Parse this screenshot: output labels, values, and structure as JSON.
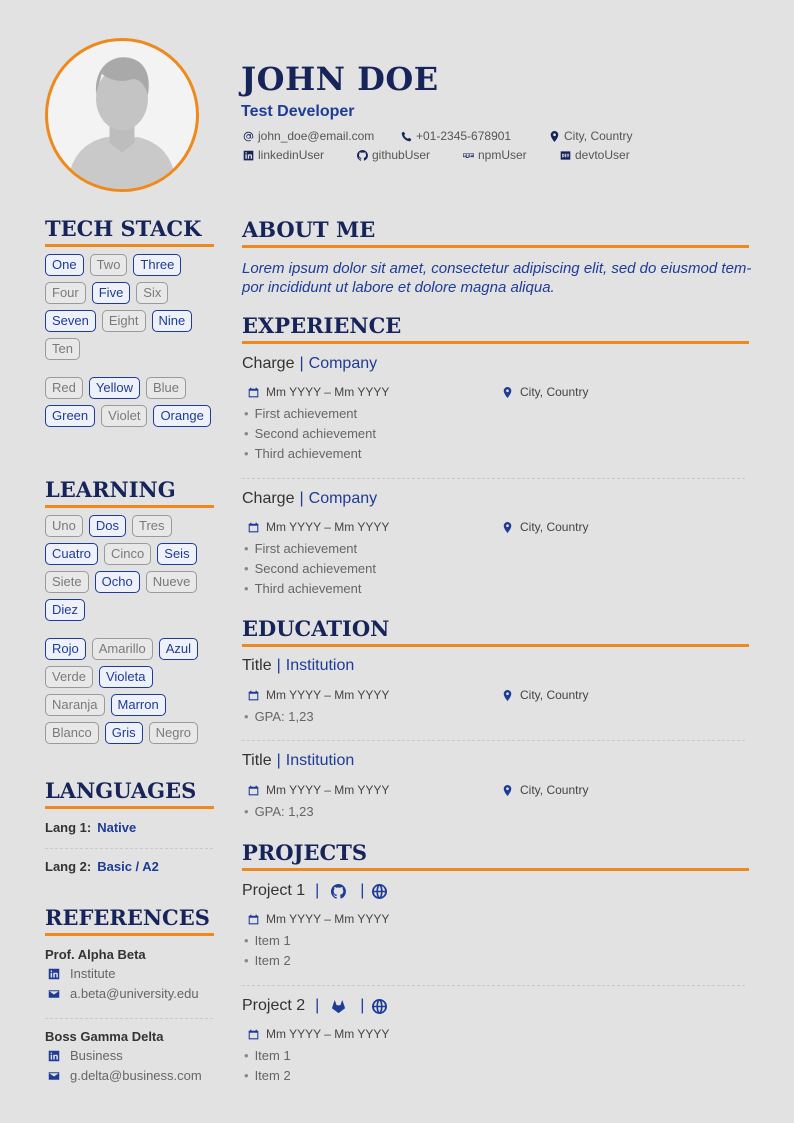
{
  "header": {
    "name": "JOHN DOE",
    "role": "Test Developer",
    "email": "john_doe@email.com",
    "phone": "+01-2345-678901",
    "location": "City, Country",
    "linkedin": "linkedinUser",
    "github": "githubUser",
    "npm": "npmUser",
    "devto": "devtoUser"
  },
  "sections": {
    "tech_stack": "TECH STACK",
    "learning": "LEARNING",
    "languages": "LANGUAGES",
    "references": "REFERENCES",
    "about": "ABOUT ME",
    "experience": "EXPERIENCE",
    "education": "EDUCATION",
    "projects": "PROJECTS"
  },
  "tech_stack": {
    "group1": [
      {
        "label": "One",
        "on": true
      },
      {
        "label": "Two",
        "on": false
      },
      {
        "label": "Three",
        "on": true
      },
      {
        "label": "Four",
        "on": false
      },
      {
        "label": "Five",
        "on": true
      },
      {
        "label": "Six",
        "on": false
      },
      {
        "label": "Seven",
        "on": true
      },
      {
        "label": "Eight",
        "on": false
      },
      {
        "label": "Nine",
        "on": true
      },
      {
        "label": "Ten",
        "on": false
      }
    ],
    "group2": [
      {
        "label": "Red",
        "on": false
      },
      {
        "label": "Yellow",
        "on": true
      },
      {
        "label": "Blue",
        "on": false
      },
      {
        "label": "Green",
        "on": true
      },
      {
        "label": "Violet",
        "on": false
      },
      {
        "label": "Orange",
        "on": true
      }
    ]
  },
  "learning": {
    "group1": [
      {
        "label": "Uno",
        "on": false
      },
      {
        "label": "Dos",
        "on": true
      },
      {
        "label": "Tres",
        "on": false
      },
      {
        "label": "Cuatro",
        "on": true
      },
      {
        "label": "Cinco",
        "on": false
      },
      {
        "label": "Seis",
        "on": true
      },
      {
        "label": "Siete",
        "on": false
      },
      {
        "label": "Ocho",
        "on": true
      },
      {
        "label": "Nueve",
        "on": false
      },
      {
        "label": "Diez",
        "on": true
      }
    ],
    "group2": [
      {
        "label": "Rojo",
        "on": true
      },
      {
        "label": "Amarillo",
        "on": false
      },
      {
        "label": "Azul",
        "on": true
      },
      {
        "label": "Verde",
        "on": false
      },
      {
        "label": "Violeta",
        "on": true
      },
      {
        "label": "Naranja",
        "on": false
      },
      {
        "label": "Marron",
        "on": true
      },
      {
        "label": "Blanco",
        "on": false
      },
      {
        "label": "Gris",
        "on": true
      },
      {
        "label": "Negro",
        "on": false
      }
    ]
  },
  "languages": [
    {
      "name": "Lang 1:",
      "level": "Native"
    },
    {
      "name": "Lang 2:",
      "level": "Basic / A2"
    }
  ],
  "references": [
    {
      "name": "Prof. Alpha Beta",
      "org": "Institute",
      "email": "a.beta@university.edu"
    },
    {
      "name": "Boss Gamma Delta",
      "org": "Business",
      "email": "g.delta@business.com"
    }
  ],
  "about": "Lorem ipsum dolor sit amet, consectetur adipiscing elit, sed do eiusmod tem-por incididunt ut labore et dolore magna aliqua.",
  "experience": [
    {
      "title": "Charge",
      "org": "Company",
      "dates": "Mm YYYY – Mm YYYY",
      "location": "City, Country",
      "items": [
        "First achievement",
        "Second achievement",
        "Third achievement"
      ]
    },
    {
      "title": "Charge",
      "org": "Company",
      "dates": "Mm YYYY – Mm YYYY",
      "location": "City, Country",
      "items": [
        "First achievement",
        "Second achievement",
        "Third achievement"
      ]
    }
  ],
  "education": [
    {
      "title": "Title",
      "org": "Institution",
      "dates": "Mm YYYY – Mm YYYY",
      "location": "City, Country",
      "items": [
        "GPA: 1,23"
      ]
    },
    {
      "title": "Title",
      "org": "Institution",
      "dates": "Mm YYYY – Mm YYYY",
      "location": "City, Country",
      "items": [
        "GPA: 1,23"
      ]
    }
  ],
  "projects": [
    {
      "title": "Project 1",
      "repo_icon": "github-icon",
      "dates": "Mm YYYY – Mm YYYY",
      "items": [
        "Item 1",
        "Item 2"
      ]
    },
    {
      "title": "Project 2",
      "repo_icon": "gitlab-icon",
      "dates": "Mm YYYY – Mm YYYY",
      "items": [
        "Item 1",
        "Item 2"
      ]
    }
  ],
  "colors": {
    "accent": "#ee8a1d",
    "navy": "#16245a",
    "blue": "#1e3c96",
    "background": "#e2e2e2"
  }
}
